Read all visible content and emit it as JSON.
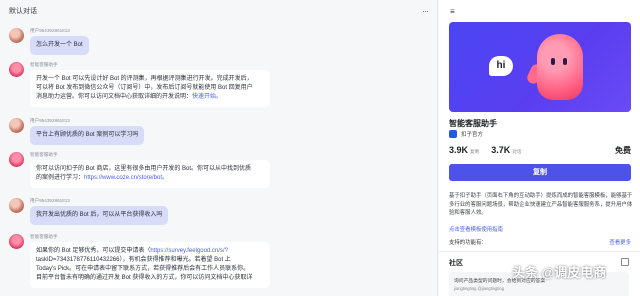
{
  "chat": {
    "title": "默认对话",
    "more_icon": "more-horizontal-icon",
    "messages": [
      {
        "sender": "用户954392861813",
        "text": "怎么开发一个 Bot",
        "role": "user"
      },
      {
        "sender": "智能客服助手",
        "text_lines": [
          "开发一个 Bot 可以先设计好 Bot 的评测集，再根据评测集进行开发。完成开发后，",
          "可以将 Bot 发布到微信公众号（订阅号）中，发布后订阅号就能使用 Bot 回复用户",
          "消息助力运营。你可以访问文档中心获取详细的开发说明："
        ],
        "link": "快速开始。",
        "role": "bot"
      },
      {
        "sender": "用户954392861813",
        "text": "平台上有顾优质的 Bot 案例可以学习吗",
        "role": "user"
      },
      {
        "sender": "智能客服助手",
        "text_lines": [
          "你可以访问扣子的 Bot 商店，这里有很多由用户开发的 Bot。你可以从中找到优质",
          "的案例进行学习："
        ],
        "link": "https://www.coze.cn/store/bot。",
        "role": "bot"
      },
      {
        "sender": "用户954392861813",
        "text": "我开发出优质的 Bot 后，可以从平台获得收入吗",
        "role": "user"
      },
      {
        "sender": "智能客服助手",
        "text_lines": [
          "如果你的 Bot 足够优秀，可以提交申请表（",
          "taskID=7343178776110432266），有机会获得推荐和曝光。若着望 Bot 上",
          "Today's Pick。可在申请表中留下联系方式，若获得推荐后会有工作人员联系你。",
          "目前平台暂未有明确的通过开发 Bot 获得收入的方式，你可以访问文档中心获取详"
        ],
        "link": "https://survey.feelgood.cn/s/?",
        "role": "bot"
      }
    ]
  },
  "panel": {
    "menu_icon": "menu-collapse-icon",
    "hero_badge": "hi",
    "bot_name": "智能客服助手",
    "author": "扣子官方",
    "stats": [
      {
        "value": "3.9K",
        "label": "复制"
      },
      {
        "value": "3.7K",
        "label": "对话"
      }
    ],
    "price": "免费",
    "copy_button": "复制",
    "description": "基于扣子助手（页面右下角的互动助手）提炼而成的智能客服模板，能够基于多行业的客服问题场景，帮助企业快速建立产品智能客服服务系，提升用户体验和客服人效。",
    "guide_link": "点击查看模板使用指南",
    "features_label": "支持的功能有：",
    "features_link": "查看更多",
    "community_title": "社区",
    "post_text": "询问产品类型的问题时，会给到对应的答案",
    "post_user": "jiangtingting @jiangtingting"
  },
  "watermark": "头条 @调皮电商"
}
